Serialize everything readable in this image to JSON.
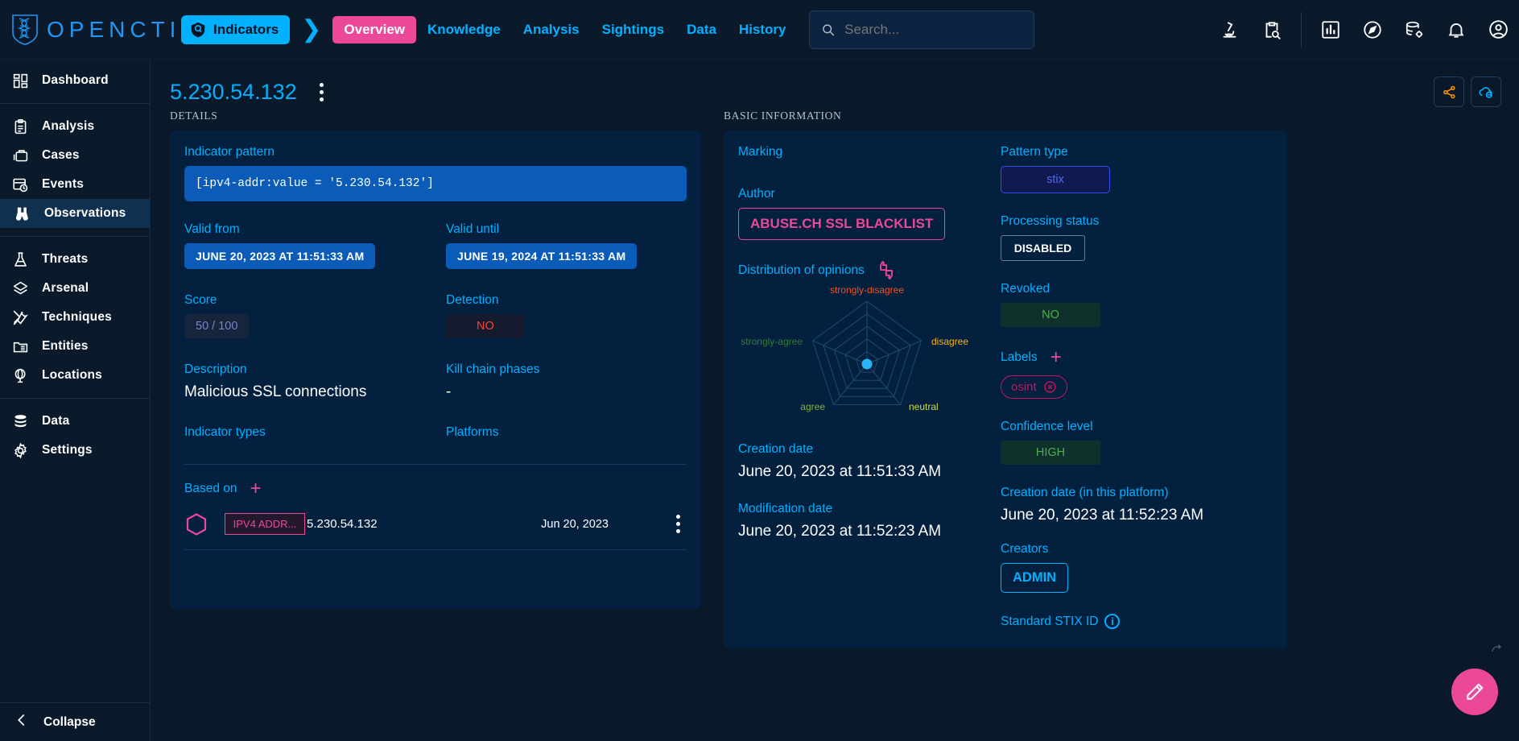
{
  "brand": {
    "name": "OPENCTI",
    "logo_icon": "dna-shield-logo"
  },
  "topbar": {
    "breadcrumb": {
      "icon": "indicator-shield-icon",
      "label": "Indicators",
      "separator_icon": "chevron-right-icon"
    },
    "tabs": [
      {
        "label": "Overview",
        "active": true
      },
      {
        "label": "Knowledge",
        "active": false
      },
      {
        "label": "Analysis",
        "active": false
      },
      {
        "label": "Sightings",
        "active": false
      },
      {
        "label": "Data",
        "active": false
      },
      {
        "label": "History",
        "active": false
      }
    ],
    "search": {
      "placeholder": "Search...",
      "value": "",
      "icon": "search-icon"
    },
    "icons": [
      {
        "name": "microscope-icon"
      },
      {
        "name": "clipboard-search-icon"
      },
      {
        "name": "bar-chart-icon"
      },
      {
        "name": "compass-icon"
      },
      {
        "name": "database-gear-icon"
      },
      {
        "name": "bell-icon"
      },
      {
        "name": "account-circle-icon"
      }
    ]
  },
  "sidebar": {
    "groups": [
      {
        "items": [
          {
            "label": "Dashboard",
            "icon": "dashboard-icon",
            "active": false
          }
        ]
      },
      {
        "items": [
          {
            "label": "Analysis",
            "icon": "clipboard-icon",
            "active": false
          },
          {
            "label": "Cases",
            "icon": "briefcase-icon",
            "active": false
          },
          {
            "label": "Events",
            "icon": "events-calendar-icon",
            "active": false
          },
          {
            "label": "Observations",
            "icon": "binoculars-icon",
            "active": true
          }
        ]
      },
      {
        "items": [
          {
            "label": "Threats",
            "icon": "flask-icon",
            "active": false
          },
          {
            "label": "Arsenal",
            "icon": "layers-icon",
            "active": false
          },
          {
            "label": "Techniques",
            "icon": "tools-icon",
            "active": false
          },
          {
            "label": "Entities",
            "icon": "folder-grid-icon",
            "active": false
          },
          {
            "label": "Locations",
            "icon": "globe-stand-icon",
            "active": false
          }
        ]
      },
      {
        "items": [
          {
            "label": "Data",
            "icon": "database-icon",
            "active": false
          },
          {
            "label": "Settings",
            "icon": "gear-icon",
            "active": false
          }
        ]
      }
    ],
    "collapse": {
      "label": "Collapse",
      "icon": "chevron-left-icon"
    }
  },
  "page": {
    "title": "5.230.54.132",
    "kebab_icon": "more-vert-icon",
    "actions": [
      {
        "name": "share-button",
        "icon": "share-icon",
        "color": "#ff9800"
      },
      {
        "name": "enrichment-button",
        "icon": "cloud-refresh-icon",
        "color": "#00b1ff"
      }
    ],
    "fab": {
      "name": "edit-fab",
      "icon": "pencil-icon",
      "color": "#ec4899"
    }
  },
  "details": {
    "section_label": "Details",
    "indicator_pattern": {
      "label": "Indicator pattern",
      "value": "[ipv4-addr:value = '5.230.54.132']"
    },
    "valid_from": {
      "label": "Valid from",
      "value": "JUNE 20, 2023 AT 11:51:33 AM"
    },
    "valid_until": {
      "label": "Valid until",
      "value": "JUNE 19, 2024 AT 11:51:33 AM"
    },
    "score": {
      "label": "Score",
      "value": "50 / 100"
    },
    "detection": {
      "label": "Detection",
      "value": "NO"
    },
    "description": {
      "label": "Description",
      "value": "Malicious SSL connections"
    },
    "kill_chain_phases": {
      "label": "Kill chain phases",
      "value": "-"
    },
    "indicator_types": {
      "label": "Indicator types",
      "value": ""
    },
    "platforms": {
      "label": "Platforms",
      "value": ""
    },
    "based_on": {
      "label": "Based on",
      "add_icon": "plus-icon",
      "rows": [
        {
          "entity_icon": "hexagon-icon",
          "type": "IPV4 ADDR...",
          "value": "5.230.54.132",
          "date": "Jun 20, 2023",
          "menu_icon": "more-vert-icon"
        }
      ]
    }
  },
  "basic_information": {
    "section_label": "Basic information",
    "marking": {
      "label": "Marking",
      "value": ""
    },
    "author": {
      "label": "Author",
      "value": "ABUSE.CH SSL BLACKLIST"
    },
    "distribution_of_opinions": {
      "label": "Distribution of opinions",
      "icon": "thumbs-icon"
    },
    "creation_date": {
      "label": "Creation date",
      "value": "June 20, 2023 at 11:51:33 AM"
    },
    "modification_date": {
      "label": "Modification date",
      "value": "June 20, 2023 at 11:52:23 AM"
    },
    "pattern_type": {
      "label": "Pattern type",
      "value": "stix"
    },
    "processing_status": {
      "label": "Processing status",
      "value": "DISABLED"
    },
    "revoked": {
      "label": "Revoked",
      "value": "NO"
    },
    "labels": {
      "label": "Labels",
      "add_icon": "plus-icon",
      "items": [
        {
          "text": "osint",
          "remove_icon": "close-circle-icon"
        }
      ]
    },
    "confidence_level": {
      "label": "Confidence level",
      "value": "HIGH"
    },
    "creation_date_platform": {
      "label": "Creation date (in this platform)",
      "value": "June 20, 2023 at 11:52:23 AM"
    },
    "creators": {
      "label": "Creators",
      "items": [
        "ADMIN"
      ]
    },
    "standard_stix_id": {
      "label": "Standard STIX ID",
      "info_icon": "info-icon"
    }
  },
  "chart_data": {
    "type": "radar",
    "title": "Distribution of opinions",
    "axes": [
      {
        "label": "strongly-disagree",
        "color": "#f4511e",
        "value": 0
      },
      {
        "label": "disagree",
        "color": "#ffb300",
        "value": 0
      },
      {
        "label": "neutral",
        "color": "#cddc39",
        "value": 0
      },
      {
        "label": "agree",
        "color": "#7cb342",
        "value": 0
      },
      {
        "label": "strongly-agree",
        "color": "#2e7d32",
        "value": 0
      }
    ],
    "rings": 5,
    "point_color": "#29b6f6",
    "grid": true,
    "legend": "none"
  },
  "colors": {
    "accent_blue": "#00b1ff",
    "accent_pink": "#ec4899",
    "bg": "#0a1929",
    "card": "#04203f",
    "chip_blue": "#0a5cb8"
  }
}
